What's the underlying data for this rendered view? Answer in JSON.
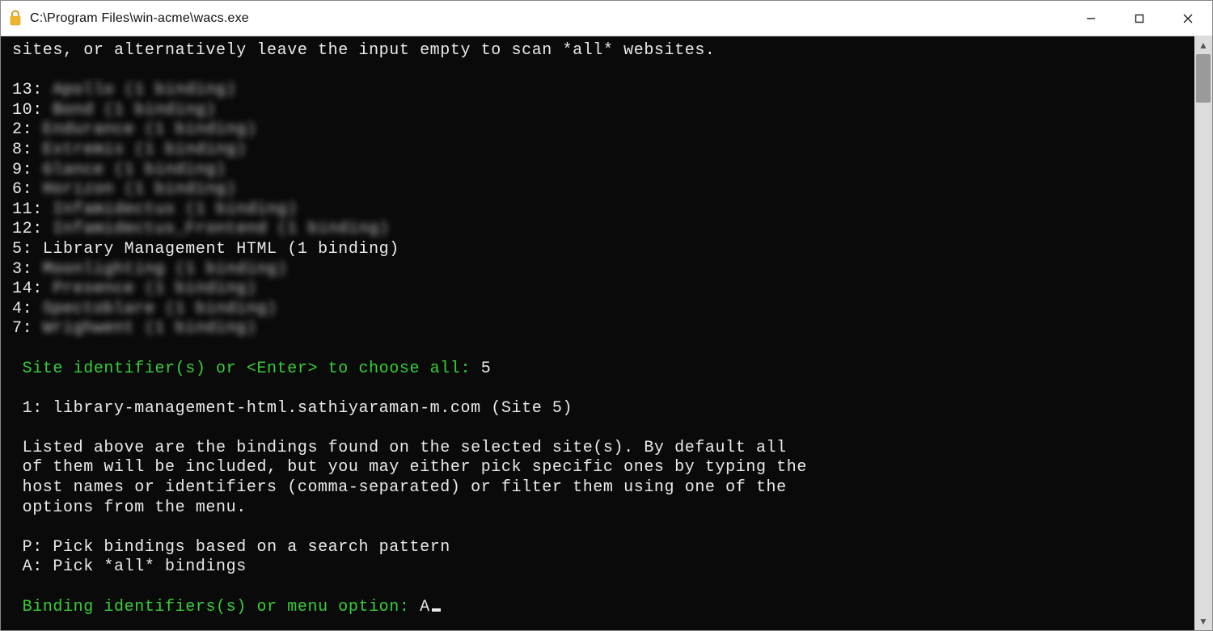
{
  "window": {
    "title": "C:\\Program Files\\win-acme\\wacs.exe"
  },
  "console": {
    "scroll_hint": "sites, or alternatively leave the input empty to scan *all* websites.",
    "sites": [
      {
        "id": "13",
        "label": "Apollo (1 binding)",
        "blurred": true
      },
      {
        "id": "10",
        "label": "Bond (1 binding)",
        "blurred": true
      },
      {
        "id": "2",
        "label": "Endurance (1 binding)",
        "blurred": true
      },
      {
        "id": "8",
        "label": "Extremis (1 binding)",
        "blurred": true
      },
      {
        "id": "9",
        "label": "Glance (1 binding)",
        "blurred": true
      },
      {
        "id": "6",
        "label": "Horizon (1 binding)",
        "blurred": true
      },
      {
        "id": "11",
        "label": "Infamidectus (1 binding)",
        "blurred": true
      },
      {
        "id": "12",
        "label": "Infamidectus_Frontend (1 binding)",
        "blurred": true
      },
      {
        "id": "5",
        "label": "Library Management HTML (1 binding)",
        "blurred": false
      },
      {
        "id": "3",
        "label": "Moonlighting (1 binding)",
        "blurred": true
      },
      {
        "id": "14",
        "label": "Presence (1 binding)",
        "blurred": true
      },
      {
        "id": "4",
        "label": "Spectoblare (1 binding)",
        "blurred": true
      },
      {
        "id": "7",
        "label": "Wrighwent (1 binding)",
        "blurred": true
      }
    ],
    "prompt1": {
      "label": "Site identifier(s) or <Enter> to choose all: ",
      "answer": "5"
    },
    "bindings": [
      {
        "id": "1",
        "label": "library-management-html.sathiyaraman-m.com (Site 5)"
      }
    ],
    "bindings_intro": "Listed above are the bindings found on the selected site(s). By default all\nof them will be included, but you may either pick specific ones by typing the\nhost names or identifiers (comma-separated) or filter them using one of the\noptions from the menu.",
    "menu": [
      {
        "key": "P",
        "label": "Pick bindings based on a search pattern"
      },
      {
        "key": "A",
        "label": "Pick *all* bindings"
      }
    ],
    "prompt2": {
      "label": "Binding identifiers(s) or menu option: ",
      "answer": "A"
    }
  }
}
